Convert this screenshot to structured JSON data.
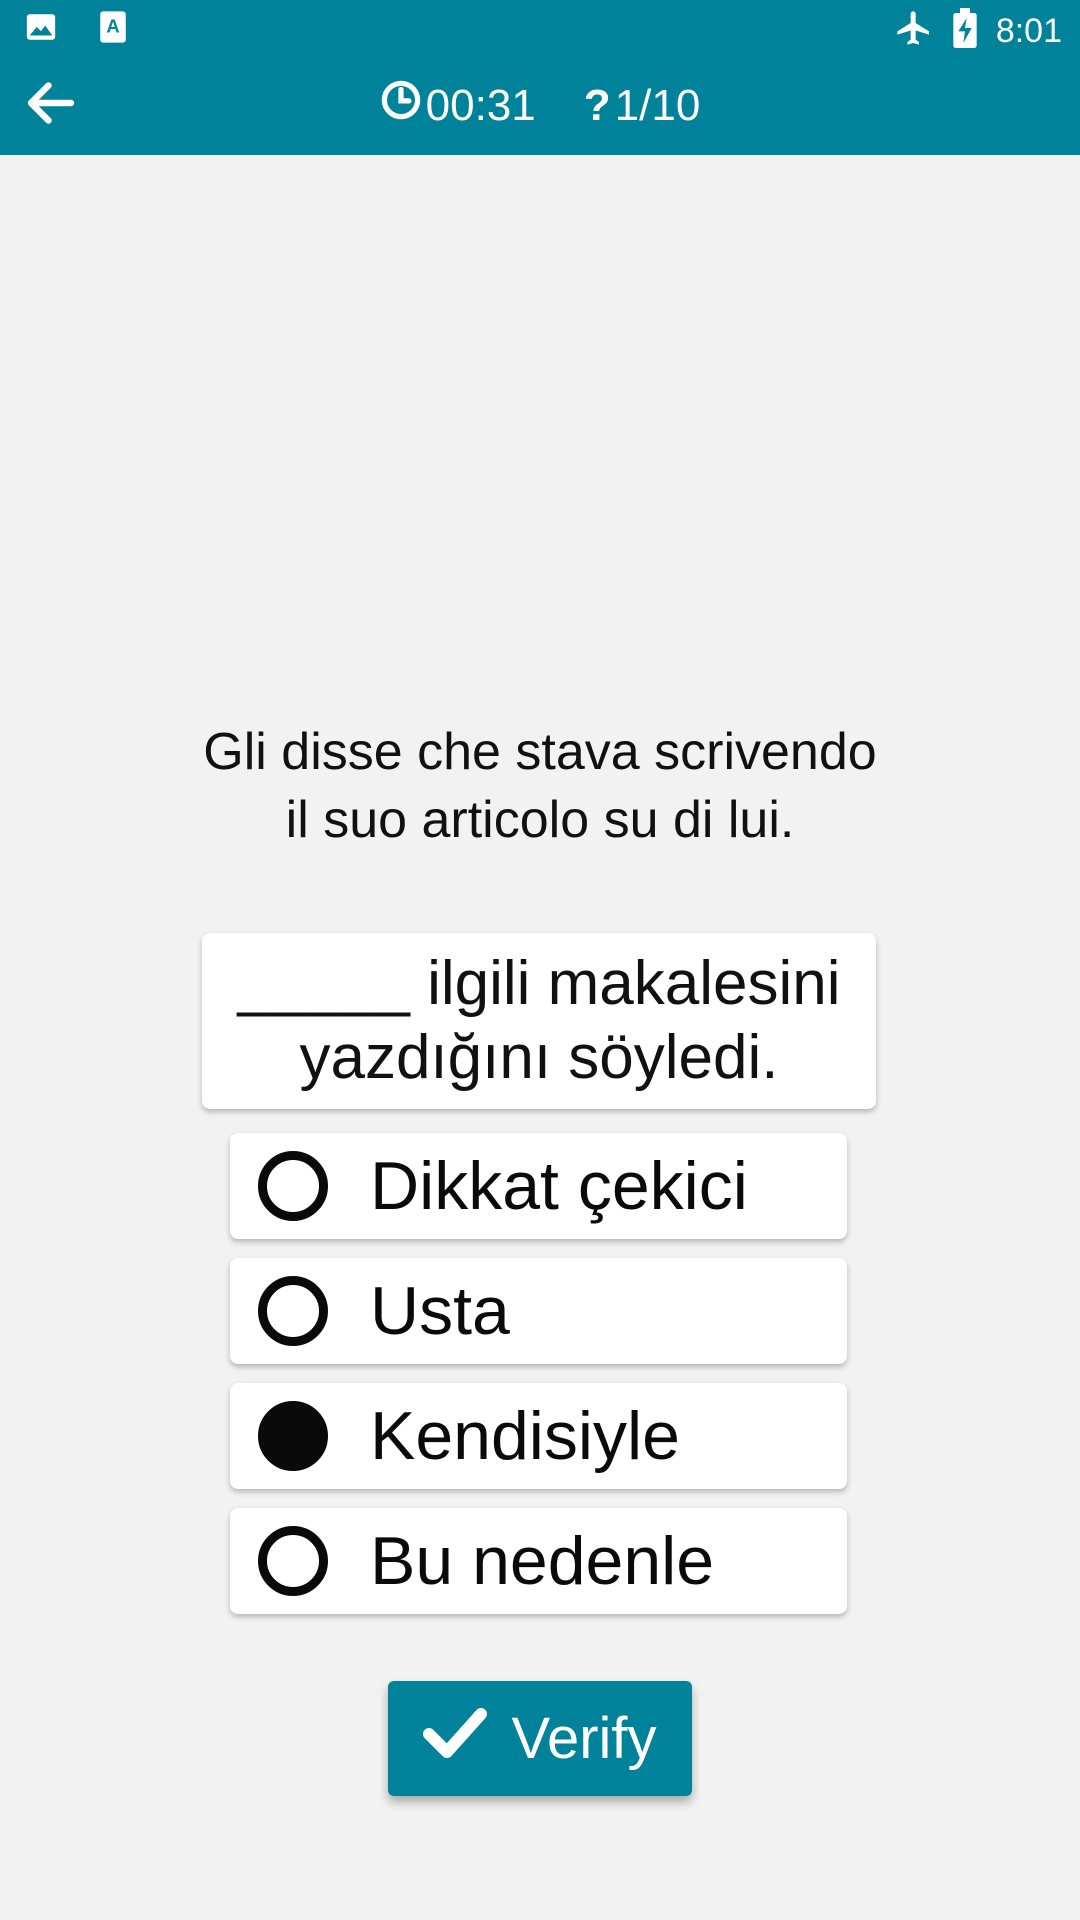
{
  "status_bar": {
    "left_icons": [
      "image-icon",
      "text-a-icon"
    ],
    "right_icons": [
      "airplane-icon",
      "battery-charging-icon"
    ],
    "time": "8:01"
  },
  "app_bar": {
    "back_icon": "arrow-left-icon",
    "timer_icon": "clock-icon",
    "timer": "00:31",
    "progress_icon": "question-icon",
    "progress": "1/10"
  },
  "question": {
    "text": "Gli disse che stava scrivendo il suo articolo su di lui."
  },
  "answer": {
    "blank": "_____",
    "text": " ilgili makalesini yazdığını söyledi."
  },
  "options": [
    {
      "label": "Dikkat çekici",
      "selected": false
    },
    {
      "label": "Usta",
      "selected": false
    },
    {
      "label": "Kendisiyle",
      "selected": true
    },
    {
      "label": "Bu nedenle",
      "selected": false
    }
  ],
  "verify_button": {
    "icon": "checkmark-icon",
    "label": "Verify"
  },
  "colors": {
    "primary": "#00829b",
    "background": "#f2f2f2",
    "card": "#ffffff",
    "text": "#0a0a0a"
  }
}
